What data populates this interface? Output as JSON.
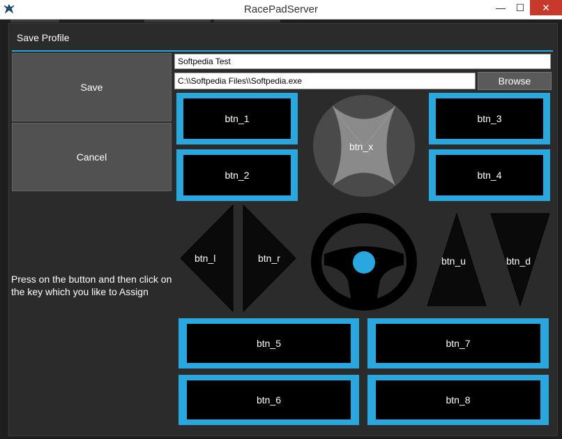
{
  "window": {
    "title": "RacePadServer",
    "minimize_glyph": "—",
    "maximize_glyph": "☐",
    "close_glyph": "✕"
  },
  "dialog": {
    "title": "Save Profile",
    "accent_color": "#29a8e0",
    "save_label": "Save",
    "cancel_label": "Cancel",
    "profile_name": "Softpedia Test",
    "exe_path": "C:\\\\Softpedia Files\\\\Softpedia.exe",
    "browse_label": "Browse",
    "instructions": "Press on the button and then click on the key which you like to Assign"
  },
  "buttons": {
    "btn_1": "btn_1",
    "btn_2": "btn_2",
    "btn_3": "btn_3",
    "btn_4": "btn_4",
    "btn_x": "btn_x",
    "btn_l": "btn_l",
    "btn_r": "btn_r",
    "btn_u": "btn_u",
    "btn_d": "btn_d",
    "btn_5": "btn_5",
    "btn_6": "btn_6",
    "btn_7": "btn_7",
    "btn_8": "btn_8"
  },
  "icons": {
    "app": "gamepad-icon",
    "x_button": "x-emblem-icon",
    "wheel": "steering-wheel-icon"
  }
}
